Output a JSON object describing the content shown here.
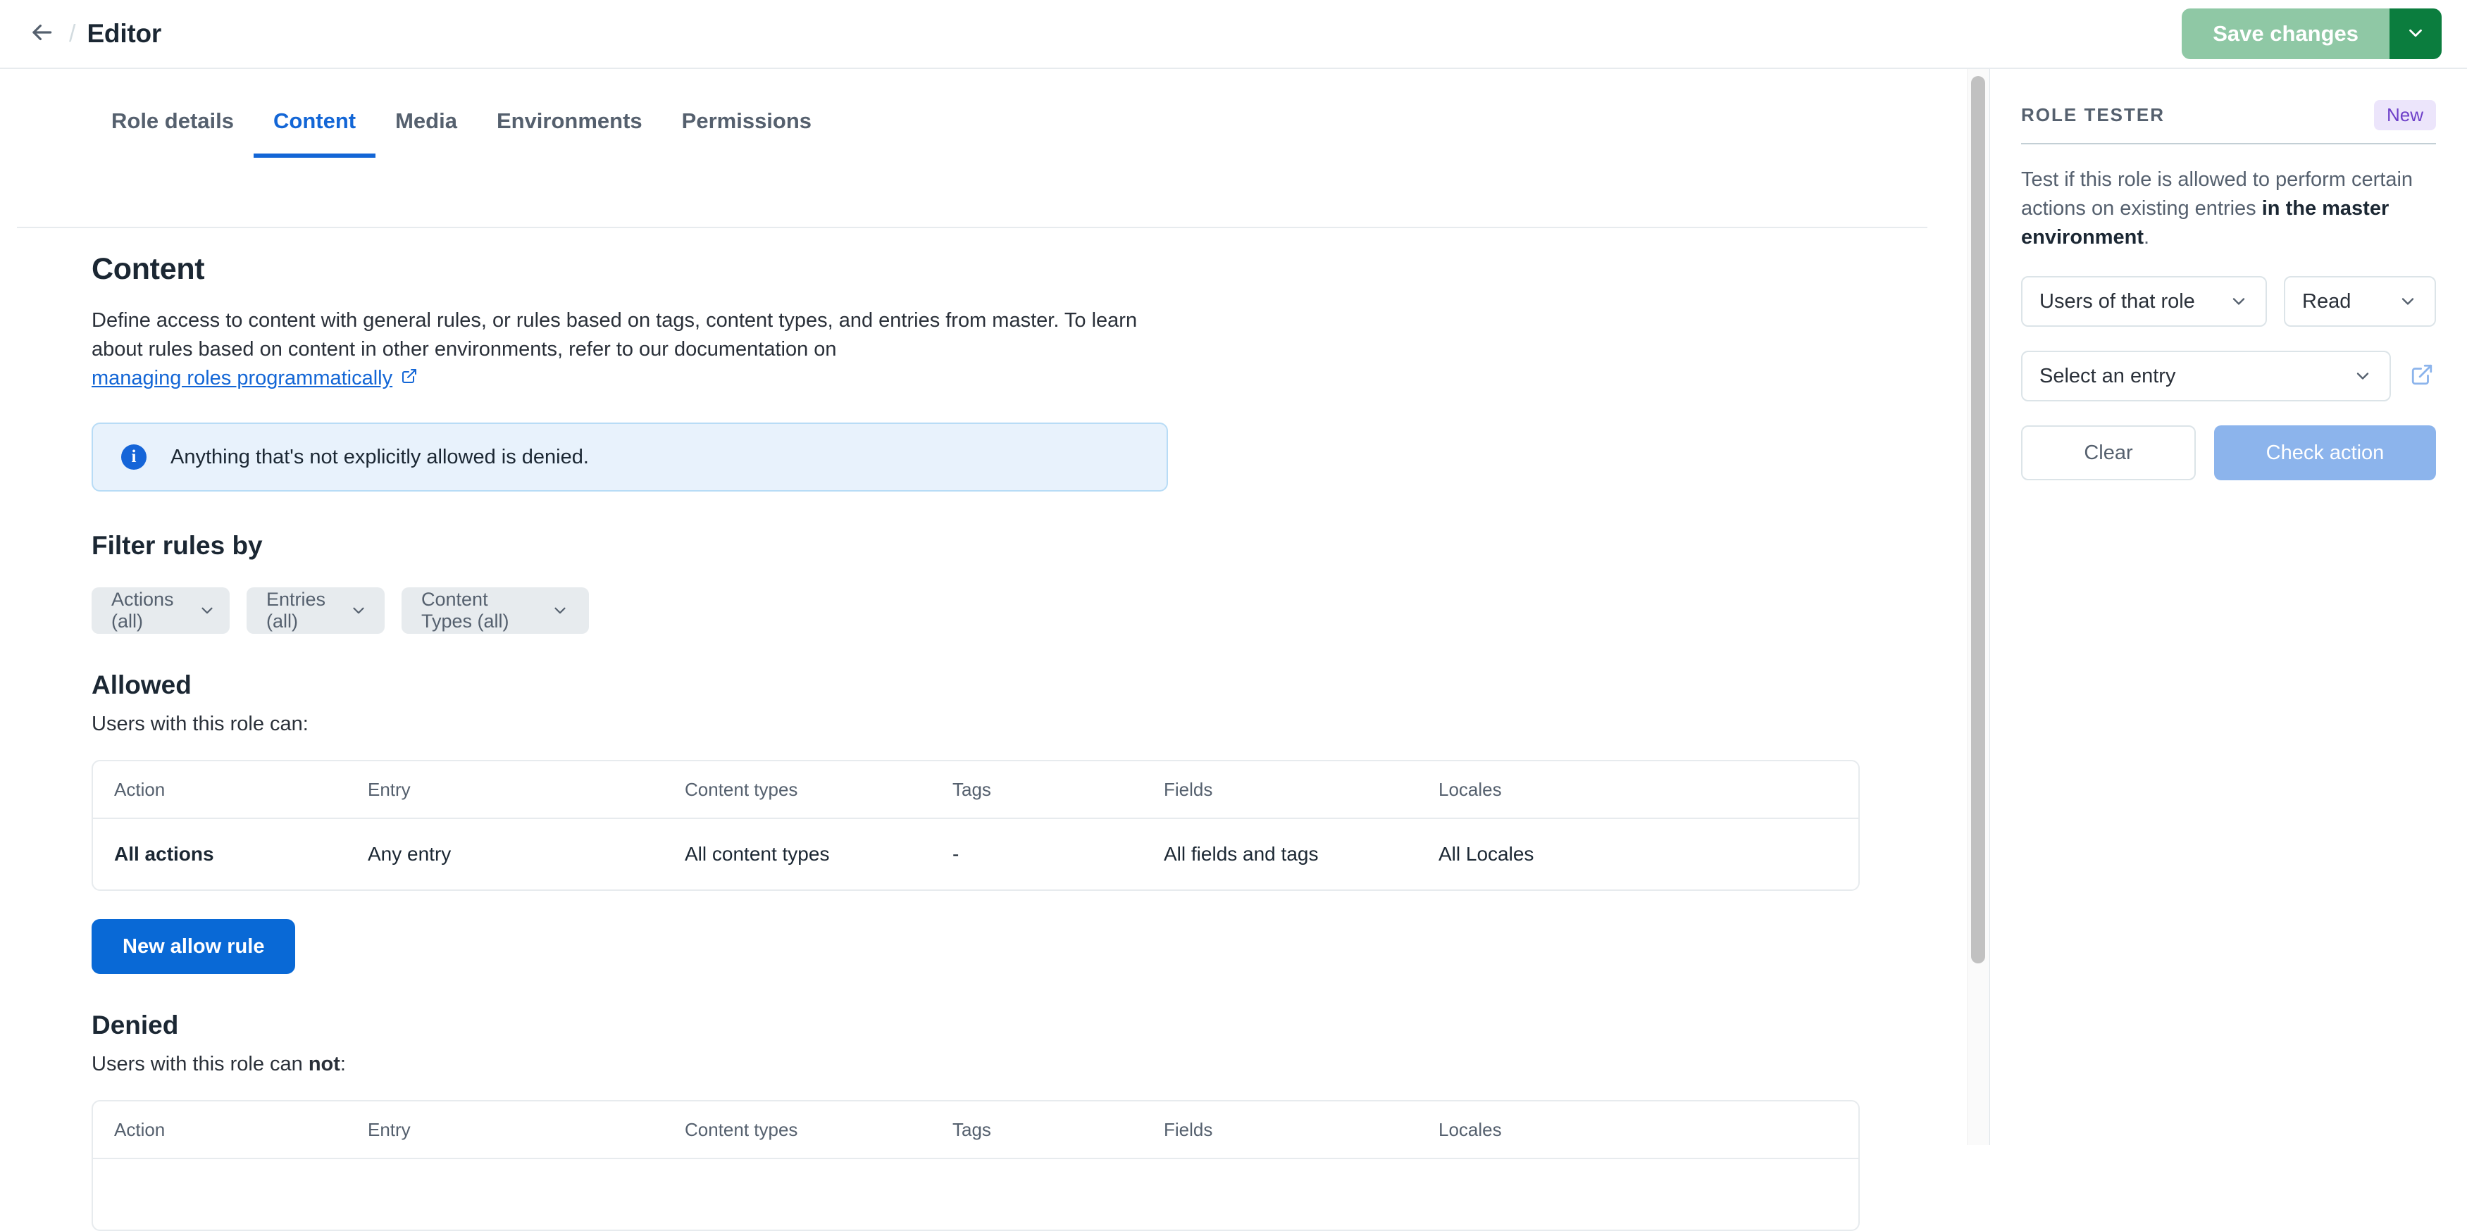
{
  "header": {
    "back_icon": "arrow-left-icon",
    "breadcrumb_separator": "/",
    "title": "Editor",
    "save_label": "Save changes",
    "save_caret_icon": "chevron-down-icon"
  },
  "tabs": [
    {
      "label": "Role details",
      "active": false
    },
    {
      "label": "Content",
      "active": true
    },
    {
      "label": "Media",
      "active": false
    },
    {
      "label": "Environments",
      "active": false
    },
    {
      "label": "Permissions",
      "active": false
    }
  ],
  "content": {
    "title": "Content",
    "description_line1": "Define access to content with general rules, or rules based on tags, content types, and entries from master. To learn",
    "description_line2": "about rules based on content in other environments, refer to our documentation on",
    "link_label": "managing roles programmatically",
    "link_icon": "external-link-icon",
    "info_icon": "info-icon",
    "info_glyph": "i",
    "info_text": "Anything that's not explicitly allowed is denied.",
    "filter_title": "Filter rules by",
    "filters": [
      {
        "label": "Actions (all)",
        "icon": "chevron-down-icon"
      },
      {
        "label": "Entries (all)",
        "icon": "chevron-down-icon"
      },
      {
        "label": "Content Types (all)",
        "icon": "chevron-down-icon"
      }
    ],
    "allowed": {
      "title": "Allowed",
      "subtitle": "Users with this role can:",
      "columns": [
        "Action",
        "Entry",
        "Content types",
        "Tags",
        "Fields",
        "Locales"
      ],
      "rows": [
        {
          "action": "All actions",
          "entry": "Any entry",
          "content_types": "All content types",
          "tags": "-",
          "fields": "All fields and tags",
          "locales": "All Locales"
        }
      ],
      "button_label": "New allow rule"
    },
    "denied": {
      "title": "Denied",
      "subtitle_prefix": "Users with this role can ",
      "subtitle_bold": "not",
      "subtitle_suffix": ":",
      "columns": [
        "Action",
        "Entry",
        "Content types",
        "Tags",
        "Fields",
        "Locales"
      ]
    }
  },
  "role_tester": {
    "title": "ROLE TESTER",
    "badge": "New",
    "description_prefix": "Test if this role is allowed to perform certain actions on existing entries ",
    "description_bold": "in the master environment",
    "description_suffix": ".",
    "who_select": "Users of that role",
    "action_select": "Read",
    "entry_select": "Select an entry",
    "entry_external_icon": "external-link-icon",
    "clear_label": "Clear",
    "check_label": "Check action",
    "chevron_icon": "chevron-down-icon"
  },
  "scrollbar": {
    "name": "vertical-scrollbar"
  },
  "colors": {
    "accent_blue": "#1366d6",
    "primary_button": "#0969d6",
    "save_green": "#0b7d3e",
    "save_green_disabled": "#8fc8a5",
    "badge_purple": "#6e40c9",
    "info_bg": "#e8f2fc"
  }
}
